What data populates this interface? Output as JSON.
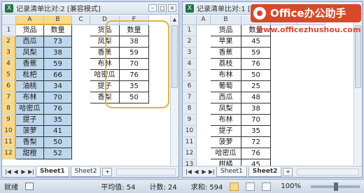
{
  "left_window": {
    "title": "记录清单比对:2 [兼容模式]",
    "columns": [
      "A",
      "B",
      "C",
      "D",
      "E"
    ],
    "rows": [
      "1",
      "2",
      "3",
      "4",
      "5",
      "6",
      "7",
      "8",
      "9",
      "10",
      "11",
      "12"
    ],
    "table_ab": {
      "headers": [
        "货品",
        "数量"
      ],
      "rows": [
        [
          "西瓜",
          "73"
        ],
        [
          "凤梨",
          "38"
        ],
        [
          "香蕉",
          "59"
        ],
        [
          "枇杷",
          "66"
        ],
        [
          "油桃",
          "34"
        ],
        [
          "布林",
          "70"
        ],
        [
          "哈密瓜",
          "76"
        ],
        [
          "提子",
          "35"
        ],
        [
          "菠萝",
          "41"
        ],
        [
          "香梨",
          "50"
        ],
        [
          "甜橙",
          "52"
        ]
      ]
    },
    "table_de": {
      "headers": [
        "货品",
        "数量"
      ],
      "rows": [
        [
          "凤梨",
          "38"
        ],
        [
          "香蕉",
          "59"
        ],
        [
          "布林",
          "70"
        ],
        [
          "哈密瓜",
          "76"
        ],
        [
          "提子",
          "35"
        ],
        [
          "香梨",
          "50"
        ]
      ]
    },
    "tabs": [
      "Sheet1",
      "Sheet2"
    ],
    "active_tab": "Sheet1"
  },
  "right_window": {
    "title": "记录清单比对:1 [兼容模",
    "columns": [
      "A",
      "B",
      "C",
      "D",
      "E"
    ],
    "rows": [
      "1",
      "2",
      "3",
      "4",
      "5",
      "6",
      "7",
      "8",
      "9",
      "10",
      "11",
      "12",
      "13"
    ],
    "table": {
      "headers": [
        "货品",
        "数量"
      ],
      "rows": [
        [
          "苹果",
          "45"
        ],
        [
          "香蕉",
          "59"
        ],
        [
          "荔枝",
          "76"
        ],
        [
          "布林",
          "50"
        ],
        [
          "葡萄",
          "25"
        ],
        [
          "西瓜",
          "48"
        ],
        [
          "凤梨",
          "38"
        ],
        [
          "布林",
          "70"
        ],
        [
          "提子",
          "35"
        ],
        [
          "菠萝",
          "72"
        ],
        [
          "哈密瓜",
          "76"
        ],
        [
          "柑橘",
          "45"
        ]
      ]
    },
    "tabs": [
      "Sheet1",
      "Sheet2"
    ],
    "active_tab": "Sheet2"
  },
  "watermark": {
    "brand": "Office办公助手",
    "url": "www.officezhushou.com"
  },
  "statusbar": {
    "ready": "就绪",
    "average": "平均值: 54",
    "count": "计数: 24",
    "sum": "求和: 594",
    "zoom": "100%"
  },
  "icons": {
    "excel": "excel-icon",
    "minimize": "minimize-icon",
    "maximize": "maximize-icon",
    "close": "close-icon",
    "macro": "macro-record-icon"
  },
  "colors": {
    "selection_fill": "#bdd7ee",
    "selected_header": "#f9d98b",
    "highlight_border": "#e3b24c",
    "watermark": "#d8492b"
  }
}
